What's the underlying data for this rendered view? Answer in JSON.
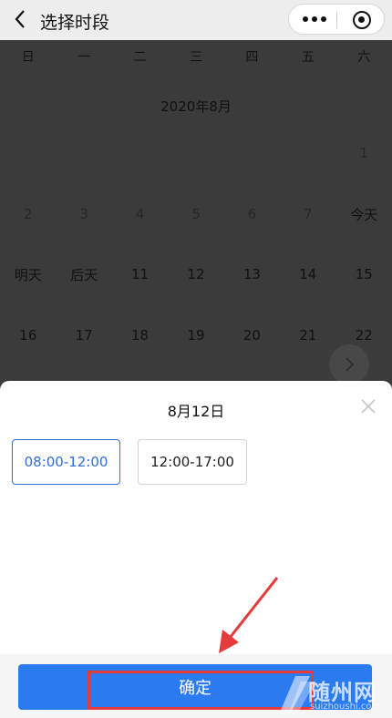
{
  "nav": {
    "title": "选择时段"
  },
  "calendar": {
    "weekdays": [
      "日",
      "一",
      "二",
      "三",
      "四",
      "五",
      "六"
    ],
    "month": "2020年8月",
    "rows": [
      [
        "",
        "",
        "",
        "",
        "",
        "",
        "1"
      ],
      [
        "2",
        "3",
        "4",
        "5",
        "6",
        "7",
        "今天"
      ],
      [
        "明天",
        "后天",
        "11",
        "12",
        "13",
        "14",
        "15"
      ],
      [
        "16",
        "17",
        "18",
        "19",
        "20",
        "21",
        "22"
      ]
    ]
  },
  "sheet": {
    "title": "8月12日",
    "slots": [
      "08:00-12:00",
      "12:00-17:00"
    ],
    "selected_slot": "08:00-12:00",
    "confirm_label": "确定"
  },
  "watermark": {
    "name": "随州网",
    "site": "suizhoushi.com"
  },
  "colors": {
    "accent": "#2b7bf0",
    "highlight": "#e53b3b"
  }
}
